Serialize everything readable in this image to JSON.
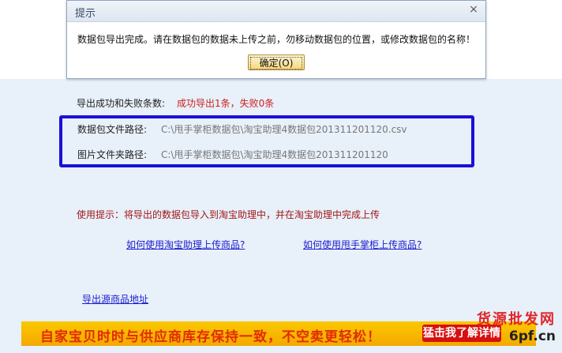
{
  "dialog": {
    "title": "提示",
    "close_glyph": "×",
    "message": "数据包导出完成。请在数据包的数据未上传之前，勿移动数据包的位置，或修改数据包的名称！",
    "ok_label": "确定(O)"
  },
  "export_result": {
    "label": "导出成功和失败条数:",
    "value": "成功导出1条，失败0条"
  },
  "package_path": {
    "label": "数据包文件路径:",
    "value": "C:\\甩手掌柜数据包\\淘宝助理4数据包201311201120.csv"
  },
  "image_path": {
    "label": "图片文件夹路径:",
    "value": "C:\\甩手掌柜数据包\\淘宝助理4数据包201311201120"
  },
  "usage_hint": "使用提示：将导出的数据包导入到淘宝助理中，并在淘宝助理中完成上传",
  "links": {
    "taobao_assistant": "如何使用淘宝助理上传商品?",
    "shuaishou": "如何使用甩手掌柜上传商品?",
    "export_source": "导出源商品地址"
  },
  "banner": {
    "text": "自家宝贝时时与供应商库存保持一致，不空卖更轻松！",
    "button": "猛击我了解详情"
  },
  "watermark": {
    "top": "货源批发网",
    "bottom": "6pf.cn"
  },
  "colors": {
    "panel_bg": "#e8f0f9",
    "highlight_border": "#1a10d8",
    "success_red": "#cc1f1f",
    "link_blue": "#1c1ccf",
    "banner_yellow": "#f4a900",
    "banner_red": "#d80f0f"
  }
}
